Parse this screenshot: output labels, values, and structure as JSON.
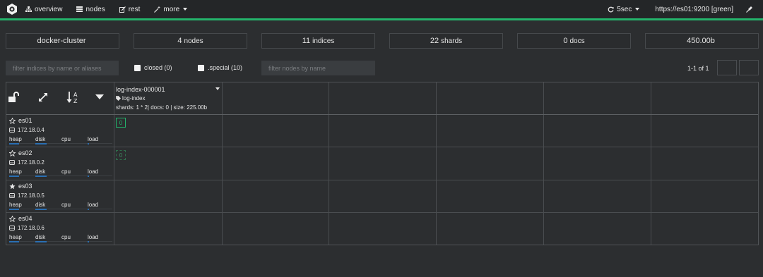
{
  "nav": {
    "items": [
      {
        "label": "overview",
        "icon": "sitemap-icon"
      },
      {
        "label": "nodes",
        "icon": "server-icon"
      },
      {
        "label": "rest",
        "icon": "edit-icon"
      },
      {
        "label": "more",
        "icon": "magic-wand-icon"
      }
    ],
    "refresh": "5sec",
    "cluster_url": "https://es01:9200 [green]"
  },
  "stats": {
    "cluster_name": "docker-cluster",
    "nodes_count": "4",
    "nodes_label": "nodes",
    "indices_count": "11",
    "indices_label": "indices",
    "shards_count": "22",
    "shards_label": "shards",
    "docs_count": "0",
    "docs_label": "docs",
    "size": "450.00b"
  },
  "filters": {
    "indices_placeholder": "filter indices by name or aliases",
    "closed_label": "closed (0)",
    "special_label": ".special (10)",
    "nodes_placeholder": "filter nodes by name",
    "pager_text": "1-1 of 1"
  },
  "index": {
    "name": "log-index-000001",
    "alias": "log-index",
    "info": "shards: 1 * 2| docs: 0 | size: 225.00b"
  },
  "nodes": [
    {
      "name": "es01",
      "ip": "172.18.0.4",
      "star": "outline",
      "shard": "0",
      "shard_type": "primary"
    },
    {
      "name": "es02",
      "ip": "172.18.0.2",
      "star": "outline",
      "shard": "0",
      "shard_type": "replica"
    },
    {
      "name": "es03",
      "ip": "172.18.0.5",
      "star": "filled"
    },
    {
      "name": "es04",
      "ip": "172.18.0.6",
      "star": "outline"
    }
  ],
  "metric_labels": {
    "heap": "heap",
    "disk": "disk",
    "cpu": "cpu",
    "load": "load"
  },
  "colors": {
    "accent_green": "#24b36b",
    "metric_blue": "#2a6fb3",
    "background": "#2c2e30"
  }
}
